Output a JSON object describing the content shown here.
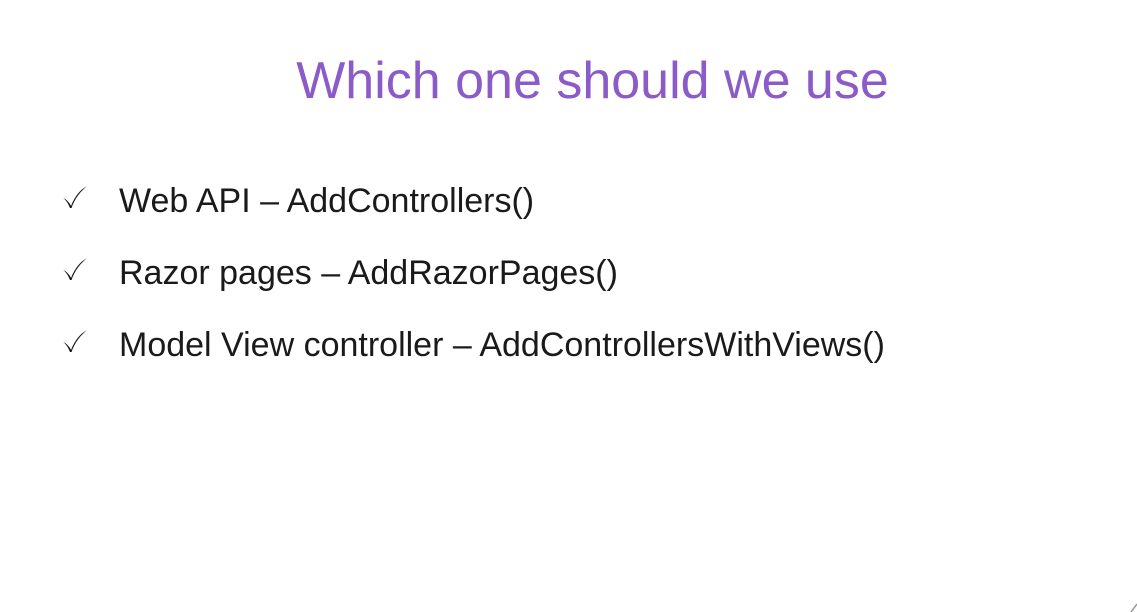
{
  "slide": {
    "title": "Which one should we use",
    "title_color": "#8b5cc7",
    "bullet_icon": "checkmark-icon",
    "bullets": [
      {
        "text": "Web API – AddControllers()"
      },
      {
        "text": "Razor pages – AddRazorPages()"
      },
      {
        "text": "Model View controller – AddControllersWithViews()"
      }
    ]
  }
}
